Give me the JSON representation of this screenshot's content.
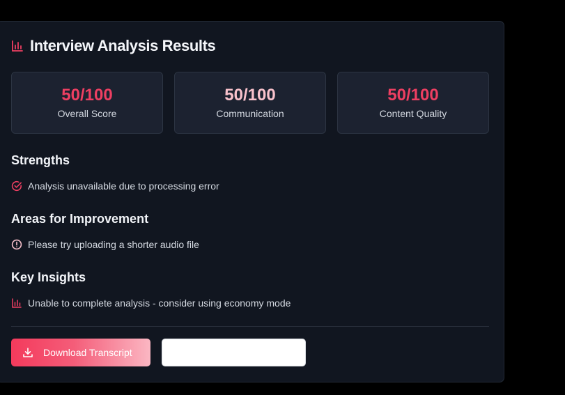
{
  "header": {
    "title": "Interview Analysis Results",
    "icon": "bar-chart-icon"
  },
  "metrics": [
    {
      "value": "50/100",
      "label": "Overall Score",
      "color": "#ee3f62"
    },
    {
      "value": "50/100",
      "label": "Communication",
      "color": "#f9c2cc"
    },
    {
      "value": "50/100",
      "label": "Content Quality",
      "color": "#ee3f62"
    }
  ],
  "strengths": {
    "title": "Strengths",
    "items": [
      {
        "text": "Analysis unavailable due to processing error",
        "icon": "check-circle-icon"
      }
    ]
  },
  "improvements": {
    "title": "Areas for Improvement",
    "items": [
      {
        "text": "Please try uploading a shorter audio file",
        "icon": "alert-circle-icon"
      }
    ]
  },
  "insights": {
    "title": "Key Insights",
    "items": [
      {
        "text": "Unable to complete analysis - consider using economy mode",
        "icon": "bar-chart-icon"
      }
    ]
  },
  "actions": {
    "download_label": "Download Transcript",
    "download_icon": "download-icon",
    "secondary_label": ""
  },
  "colors": {
    "accent": "#f43a5c",
    "accent_light": "#f9c2cc",
    "background": "#111620",
    "card": "#1c2230"
  }
}
